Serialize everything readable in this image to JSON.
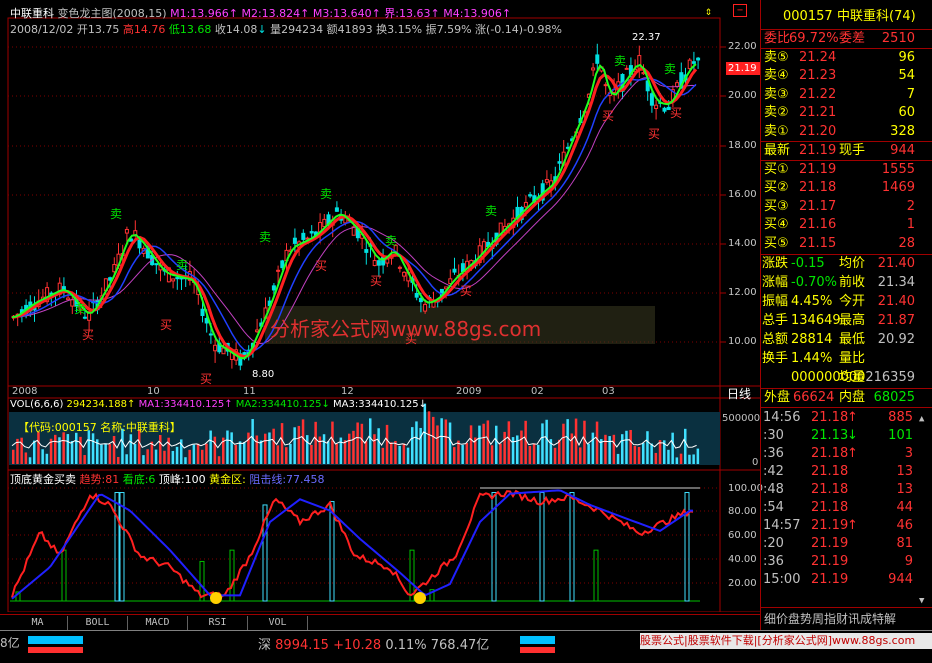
{
  "header": {
    "stock_name": "中联重科",
    "indicator": "变色龙主图",
    "params": "(2008,15)",
    "m1": "M1:13.966",
    "m2": "M2:13.824",
    "m3": "M3:13.640",
    "jie": "界:13.63",
    "m4": "M4:13.906",
    "date": "2008/12/02",
    "open": "开13.75",
    "high": "高14.76",
    "low": "低13.68",
    "close": "收14.08",
    "volume": "量294234",
    "amount": "额41893",
    "turnover": "换3.15%",
    "amplitude": "振7.59%",
    "change": "涨(-0.14)-0.98%"
  },
  "price_axis": [
    "22.00",
    "20.00",
    "18.00",
    "16.00",
    "14.00",
    "12.00",
    "10.00"
  ],
  "price_marker": "21.19",
  "high_label": "22.37",
  "low_label": "8.80",
  "watermark": "分析家公式网www.88gs.com",
  "date_axis": [
    "2008",
    "10",
    "11",
    "12",
    "2009",
    "02",
    "03"
  ],
  "period_label": "日线",
  "signals": {
    "sell": "卖",
    "buy": "买"
  },
  "vol": {
    "label": "VOL(6,6,6)",
    "value": "294234.188",
    "ma1": "MA1:334410.125",
    "ma2": "MA2:334410.125",
    "ma3": "MA3:334410.125",
    "code_box": "【代码:000157 名称:中联重科】",
    "axis": [
      "500000",
      "0"
    ]
  },
  "osc": {
    "title": "顶底黄金买卖",
    "trend": "趋势:81",
    "look_bottom": "看底:6",
    "top": "顶峰:100",
    "gold_zone": "黄金区:",
    "resist_line": "阻击线:77.458",
    "axis": [
      "100.00",
      "80.00",
      "60.00",
      "40.00",
      "20.00"
    ]
  },
  "tabs": [
    "MA",
    "BOLL",
    "MACD",
    "RSI",
    "VOL"
  ],
  "quote": {
    "code": "000157",
    "name": "中联重科(74)",
    "weibi_label": "委比",
    "weibi": "69.72%",
    "weicha_label": "委差",
    "weicha": "2510",
    "asks": [
      {
        "label": "卖⑤",
        "price": "21.24",
        "vol": "96"
      },
      {
        "label": "卖④",
        "price": "21.23",
        "vol": "54"
      },
      {
        "label": "卖③",
        "price": "21.22",
        "vol": "7"
      },
      {
        "label": "卖②",
        "price": "21.21",
        "vol": "60"
      },
      {
        "label": "卖①",
        "price": "21.20",
        "vol": "328"
      }
    ],
    "last_label": "最新",
    "last": "21.19",
    "cur_label": "现手",
    "cur": "944",
    "bids": [
      {
        "label": "买①",
        "price": "21.19",
        "vol": "1555"
      },
      {
        "label": "买②",
        "price": "21.18",
        "vol": "1469"
      },
      {
        "label": "买③",
        "price": "21.17",
        "vol": "2"
      },
      {
        "label": "买④",
        "price": "21.16",
        "vol": "1"
      },
      {
        "label": "买⑤",
        "price": "21.15",
        "vol": "28"
      }
    ],
    "stats": [
      {
        "l": "涨跌",
        "lv": "-0.15",
        "r": "均价",
        "rv": "21.40"
      },
      {
        "l": "涨幅",
        "lv": "-0.70%",
        "r": "前收",
        "rv": "21.34"
      },
      {
        "l": "振幅",
        "lv": "4.45%",
        "r": "今开",
        "rv": "21.40"
      },
      {
        "l": "总手",
        "lv": "134649",
        "r": "最高",
        "rv": "21.87"
      },
      {
        "l": "总额",
        "lv": "28814",
        "r": "最低",
        "rv": "20.92"
      },
      {
        "l": "换手",
        "lv": "1.44%",
        "r": "量比",
        "rv": ""
      },
      {
        "l": "",
        "lv": "000000000",
        "r": "均量",
        "rv": "216359"
      }
    ],
    "outer_label": "外盘",
    "outer": "66624",
    "inner_label": "内盘",
    "inner": "68025",
    "ticks": [
      {
        "t": "14:56",
        "p": "21.18",
        "a": "↑",
        "v": "885"
      },
      {
        "t": ":30",
        "p": "21.13",
        "a": "↓",
        "v": "101"
      },
      {
        "t": ":36",
        "p": "21.18",
        "a": "↑",
        "v": "3"
      },
      {
        "t": ":42",
        "p": "21.18",
        "a": "",
        "v": "13"
      },
      {
        "t": ":48",
        "p": "21.18",
        "a": "",
        "v": "13"
      },
      {
        "t": ":54",
        "p": "21.18",
        "a": "",
        "v": "44"
      },
      {
        "t": "14:57",
        "p": "21.19",
        "a": "↑",
        "v": "46"
      },
      {
        "t": ":20",
        "p": "21.19",
        "a": "",
        "v": "81"
      },
      {
        "t": ":36",
        "p": "21.19",
        "a": "",
        "v": "9"
      },
      {
        "t": "15:00",
        "p": "21.19",
        "a": "",
        "v": "944"
      }
    ],
    "bottom_menu": "细价盘势周指财讯成特解"
  },
  "status": {
    "left_fragment": "8亿",
    "sz_label": "深",
    "sz_index": "8994.15",
    "sz_change": "+10.28",
    "sz_pct": "0.11%",
    "sz_amount": "768.47亿",
    "ad": "股票公式|股票软件下载|[分析家公式网]www.88gs.com"
  },
  "chart_data": {
    "type": "candlestick",
    "symbol": "000157",
    "ylim": [
      8.8,
      22.37
    ],
    "x_labels": [
      "2008",
      "10",
      "11",
      "12",
      "2009",
      "02",
      "03"
    ],
    "last_bar": {
      "date": "2008/12/02",
      "open": 13.75,
      "high": 14.76,
      "low": 13.68,
      "close": 14.08,
      "volume": 294234
    },
    "high": 22.37,
    "low": 8.8,
    "last_price": 21.19
  }
}
